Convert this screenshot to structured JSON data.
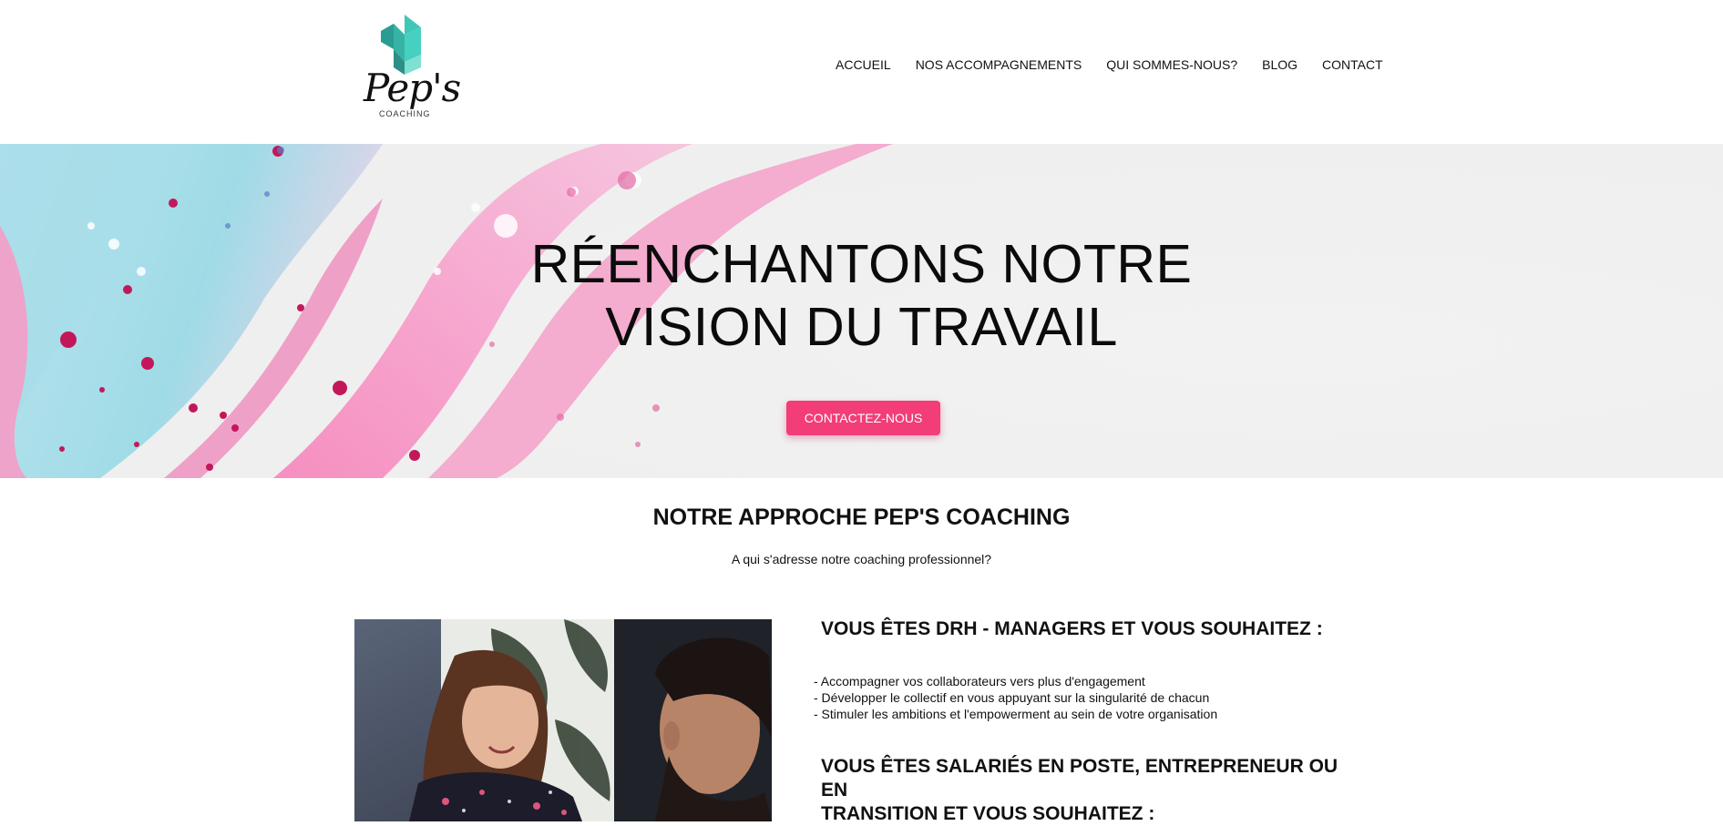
{
  "brand": {
    "name": "Pep's",
    "tagline": "COACHING",
    "colors": {
      "logo_teal": "#3fc7b8",
      "logo_teal_dark": "#2a9d93",
      "accent": "#f23d79"
    }
  },
  "nav": {
    "items": [
      {
        "label": "ACCUEIL"
      },
      {
        "label": "NOS ACCOMPAGNEMENTS"
      },
      {
        "label": "QUI SOMMES-NOUS?"
      },
      {
        "label": "BLOG"
      },
      {
        "label": "CONTACT"
      }
    ]
  },
  "hero": {
    "title_line1": "RÉENCHANTONS NOTRE",
    "title_line2": "VISION DU TRAVAIL",
    "cta_label": "CONTACTEZ-NOUS"
  },
  "approach": {
    "title": "NOTRE APPROCHE PEP'S COACHING",
    "subtitle": "A qui s'adresse notre coaching professionnel?",
    "block1": {
      "heading": "VOUS ÊTES DRH - MANAGERS ET VOUS SOUHAITEZ :",
      "bullets": [
        "- Accompagner vos collaborateurs vers plus d'engagement",
        "- Développer le collectif en vous appuyant sur la singularité de chacun",
        "- Stimuler les ambitions et l'empowerment au sein de votre organisation"
      ]
    },
    "block2": {
      "heading_line1": "VOUS ÊTES SALARIÉS EN POSTE, ENTREPRENEUR OU EN",
      "heading_line2": "TRANSITION ET VOUS SOUHAITEZ :"
    }
  }
}
